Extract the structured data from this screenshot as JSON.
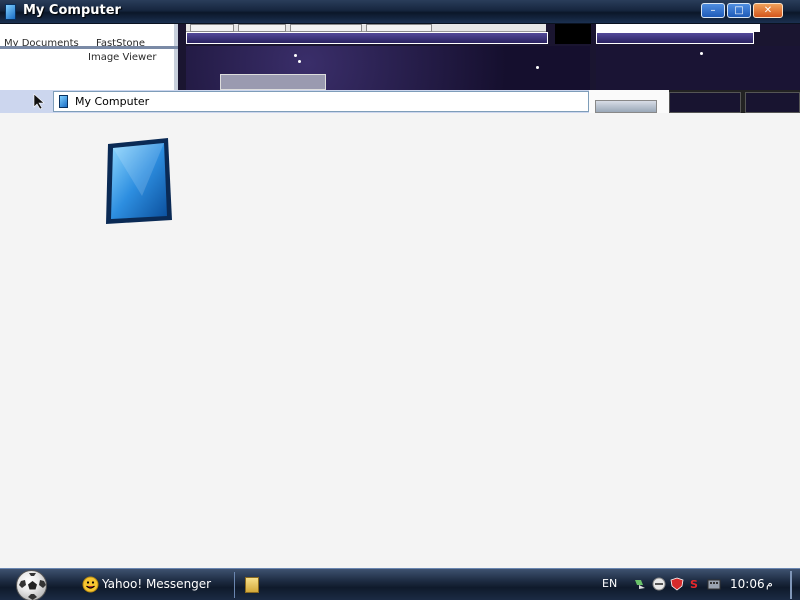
{
  "window": {
    "title": "My Computer",
    "minimize_glyph": "–",
    "maximize_glyph": "□",
    "close_glyph": "✕"
  },
  "background": {
    "desktop_labels": [
      "My Documents",
      "FastStone",
      "Image Viewer"
    ]
  },
  "address_bar": {
    "location": "My Computer"
  },
  "taskbar": {
    "task_label": "Yahoo! Messenger",
    "language": "EN",
    "clock": "10:06",
    "clock_suffix": "م"
  },
  "colors": {
    "taskbar": "#1c2a40",
    "titlebar": "#16263f",
    "address_bar": "#ccd6ee",
    "content_background": "#f4f4f4",
    "accent_blue": "#1a6cc4"
  },
  "icons": {
    "titlebar": "my-computer-icon",
    "big": "monitor-icon",
    "start": "soccer-ball-icon",
    "task": "yahoo-smiley-icon"
  }
}
